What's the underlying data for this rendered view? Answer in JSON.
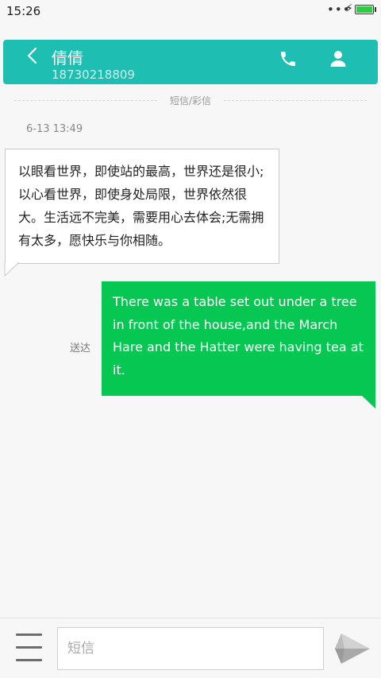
{
  "status_bar": {
    "time": "15:26",
    "dots": "•••",
    "charging_symbol": "⚡",
    "battery_color": "#2ecc40"
  },
  "header": {
    "background_color": "#1ebfb2",
    "contact_name": "倩倩",
    "contact_number": "18730218809",
    "back_icon": "chevron-left-icon",
    "call_icon": "phone-icon",
    "contact_icon": "person-icon"
  },
  "conversation": {
    "channel_label": "短信/彩信",
    "timestamp": "6-13 13:49",
    "messages": [
      {
        "direction": "incoming",
        "text": "以眼看世界，即使站的最高，世界还是很小;以心看世界，即使身处局限，世界依然很大。生活远不完美，需要用心去体会;无需拥有太多，愿快乐与你相随。",
        "bubble_color": "#ffffff"
      },
      {
        "direction": "outgoing",
        "text": "There was a table set out under a tree in front of the house,and the March Hare and the Hatter were having tea at it.",
        "status": "送达",
        "bubble_color": "#06c752"
      }
    ]
  },
  "composer": {
    "menu_icon": "hamburger-menu-icon",
    "placeholder": "短信",
    "value": "",
    "send_icon": "send-paper-plane-icon"
  }
}
